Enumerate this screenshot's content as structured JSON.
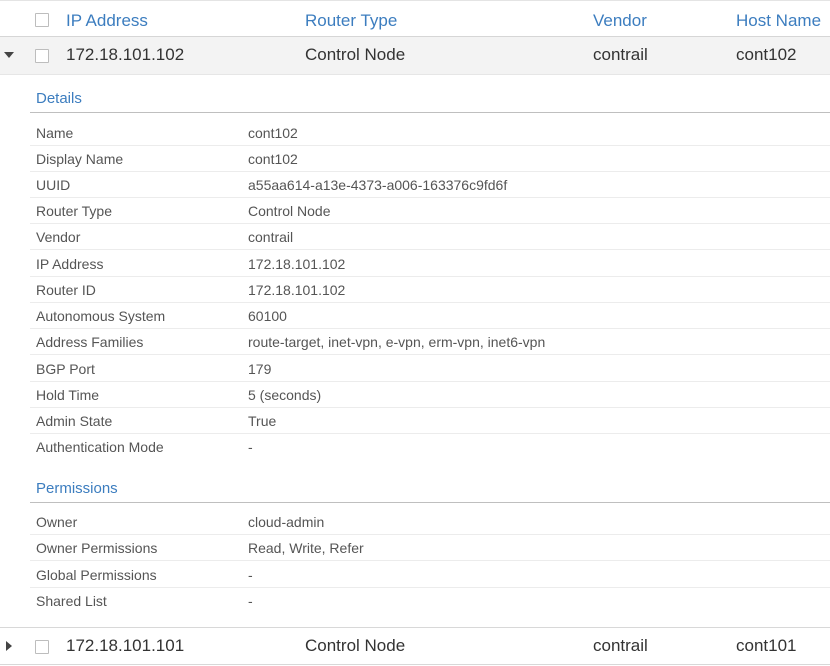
{
  "grid": {
    "columns": [
      {
        "label": "IP Address"
      },
      {
        "label": "Router Type"
      },
      {
        "label": "Vendor"
      },
      {
        "label": "Host Name"
      }
    ],
    "rows": [
      {
        "ip": "172.18.101.102",
        "router_type": "Control Node",
        "vendor": "contrail",
        "host_name": "cont102",
        "expanded": true
      },
      {
        "ip": "172.18.101.101",
        "router_type": "Control Node",
        "vendor": "contrail",
        "host_name": "cont101",
        "expanded": false
      }
    ]
  },
  "details": {
    "title": "Details",
    "items": [
      {
        "key": "Name",
        "value": "cont102"
      },
      {
        "key": "Display Name",
        "value": "cont102"
      },
      {
        "key": "UUID",
        "value": "a55aa614-a13e-4373-a006-163376c9fd6f"
      },
      {
        "key": "Router Type",
        "value": "Control Node"
      },
      {
        "key": "Vendor",
        "value": "contrail"
      },
      {
        "key": "IP Address",
        "value": "172.18.101.102"
      },
      {
        "key": "Router ID",
        "value": "172.18.101.102"
      },
      {
        "key": "Autonomous System",
        "value": "60100"
      },
      {
        "key": "Address Families",
        "value": "route-target, inet-vpn, e-vpn, erm-vpn, inet6-vpn"
      },
      {
        "key": "BGP Port",
        "value": "179"
      },
      {
        "key": "Hold Time",
        "value": "5 (seconds)"
      },
      {
        "key": "Admin State",
        "value": "True"
      },
      {
        "key": "Authentication Mode",
        "value": "-"
      }
    ]
  },
  "permissions": {
    "title": "Permissions",
    "items": [
      {
        "key": "Owner",
        "value": "cloud-admin"
      },
      {
        "key": "Owner Permissions",
        "value": "Read, Write, Refer"
      },
      {
        "key": "Global Permissions",
        "value": "-"
      },
      {
        "key": "Shared List",
        "value": "-"
      }
    ]
  },
  "colors": {
    "accent": "#3c7dbf",
    "expanded_row_bg": "#f3f3f3",
    "text": "#333333"
  },
  "icons": {
    "expanded": "caret-down-icon",
    "collapsed": "caret-right-icon"
  }
}
